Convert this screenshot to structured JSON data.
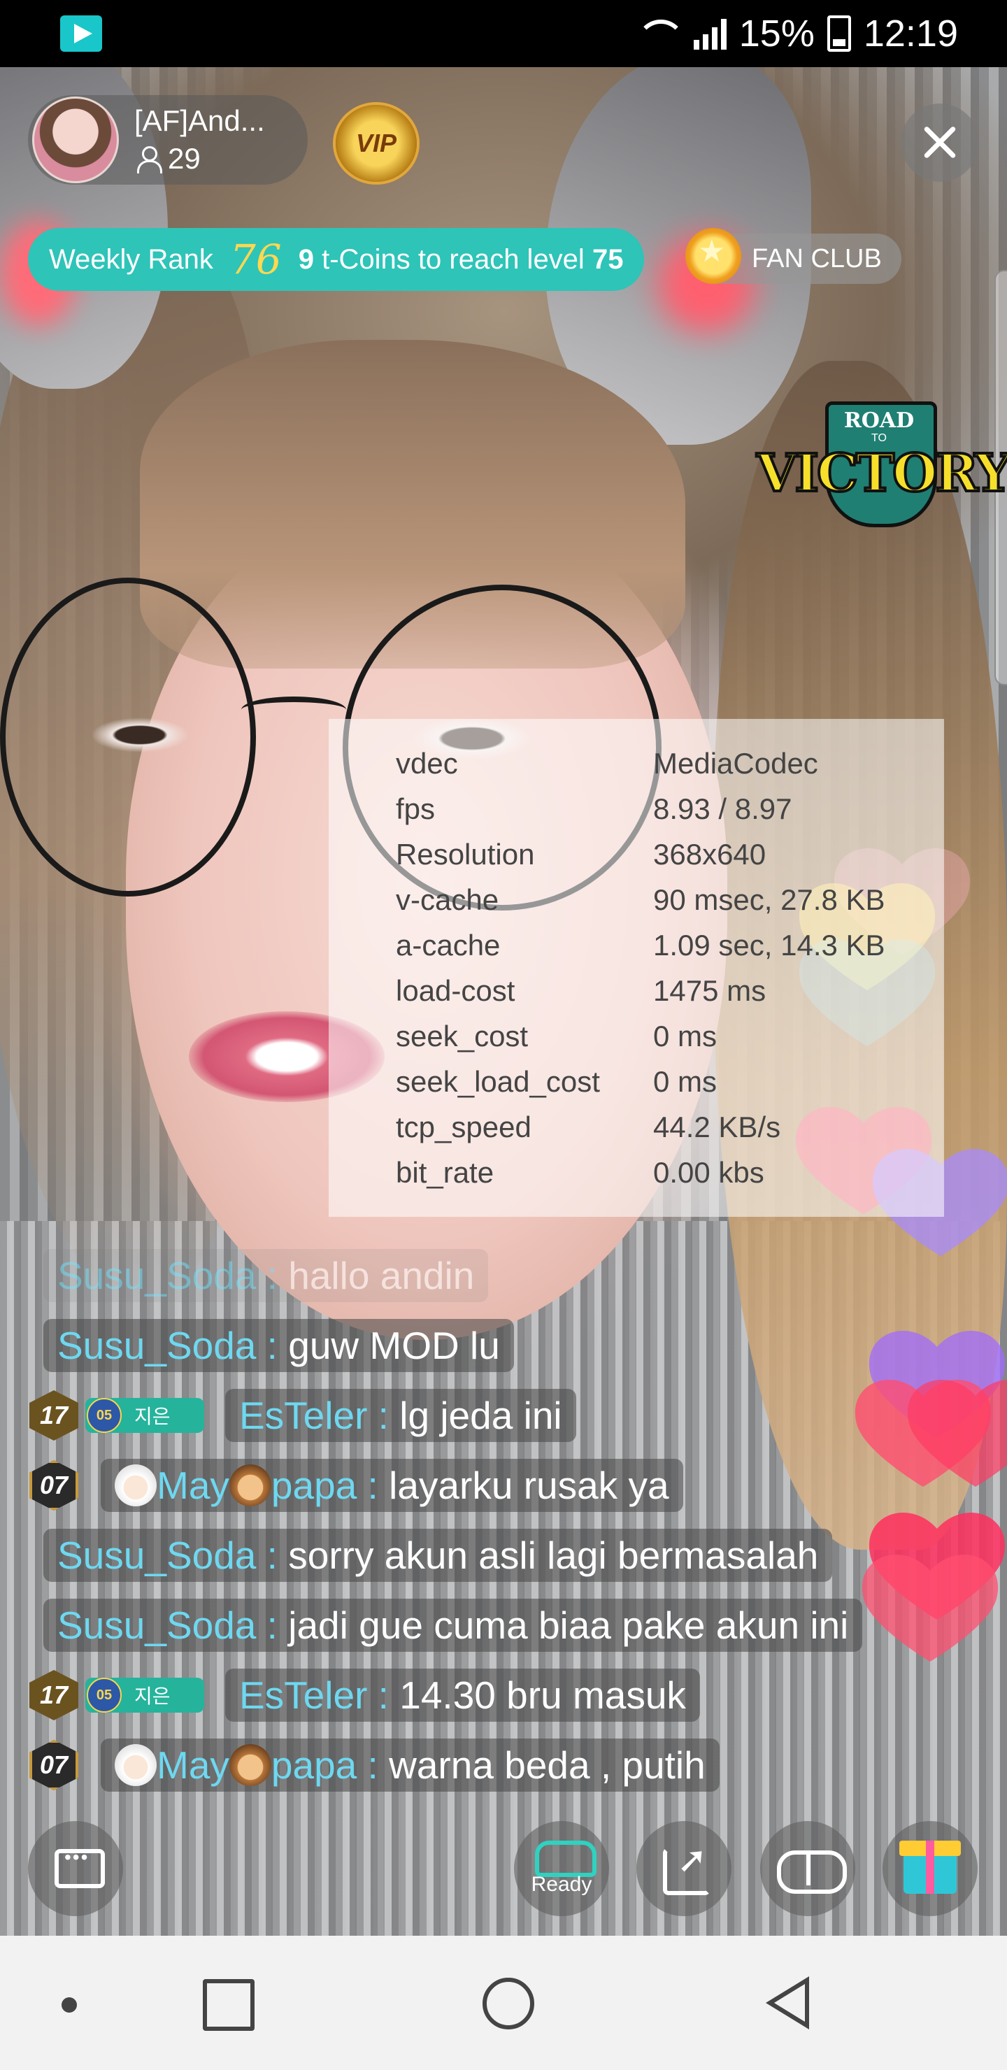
{
  "status_bar": {
    "battery": "15%",
    "time": "12:19"
  },
  "stream": {
    "streamer_name": "[AF]And...",
    "viewer_count": "29",
    "vip_label": "VIP",
    "weekly_rank_label": "Weekly Rank",
    "weekly_rank_value": "76",
    "coins_needed": "9",
    "coins_text": "t-Coins to reach level",
    "target_level": "75",
    "fan_club_label": "FAN CLUB",
    "overlay_logo": {
      "top": "ROAD",
      "middle": "TO",
      "main": "VICTORY"
    }
  },
  "debug_stats": [
    {
      "key": "vdec",
      "value": "MediaCodec"
    },
    {
      "key": "fps",
      "value": "8.93 / 8.97"
    },
    {
      "key": "Resolution",
      "value": "368x640"
    },
    {
      "key": "v-cache",
      "value": "90 msec, 27.8 KB"
    },
    {
      "key": "a-cache",
      "value": "1.09 sec, 14.3 KB"
    },
    {
      "key": "load-cost",
      "value": "1475 ms"
    },
    {
      "key": "seek_cost",
      "value": "0 ms"
    },
    {
      "key": "seek_load_cost",
      "value": "0 ms"
    },
    {
      "key": "tcp_speed",
      "value": "44.2 KB/s"
    },
    {
      "key": "bit_rate",
      "value": "0.00 kbs"
    }
  ],
  "chat": [
    {
      "user": "Susu_Soda :",
      "message": "hallo andin"
    },
    {
      "user": "Susu_Soda :",
      "message": "guw MOD lu"
    },
    {
      "level": "17",
      "fan_level": "05",
      "fan_name": "지은",
      "user": "EsTeler :",
      "message": "lg jeda ini"
    },
    {
      "level": "07",
      "user_part1": "May",
      "user_part2": "papa :",
      "message": "layarku rusak ya"
    },
    {
      "user": "Susu_Soda :",
      "message": "sorry akun asli lagi bermasalah"
    },
    {
      "user": "Susu_Soda :",
      "message": "jadi gue cuma biaa pake akun ini"
    },
    {
      "level": "17",
      "fan_level": "05",
      "fan_name": "지은",
      "user": "EsTeler :",
      "message": "14.30 bru masuk"
    },
    {
      "level": "07",
      "user_part1": "May",
      "user_part2": "papa :",
      "message": "warna beda , putih"
    }
  ],
  "actions": {
    "ready_label": "Ready"
  },
  "colors": {
    "accent": "#2ec4b8",
    "username": "#6ed8f0",
    "rank_number": "#ffd84f"
  },
  "icons": [
    "app-indicator-icon",
    "wifi-icon",
    "signal-icon",
    "battery-icon",
    "person-icon",
    "close-icon",
    "chat-icon",
    "basket-icon",
    "share-icon",
    "mask-icon",
    "gift-icon",
    "nav-back-icon",
    "nav-home-icon",
    "nav-recent-icon"
  ]
}
